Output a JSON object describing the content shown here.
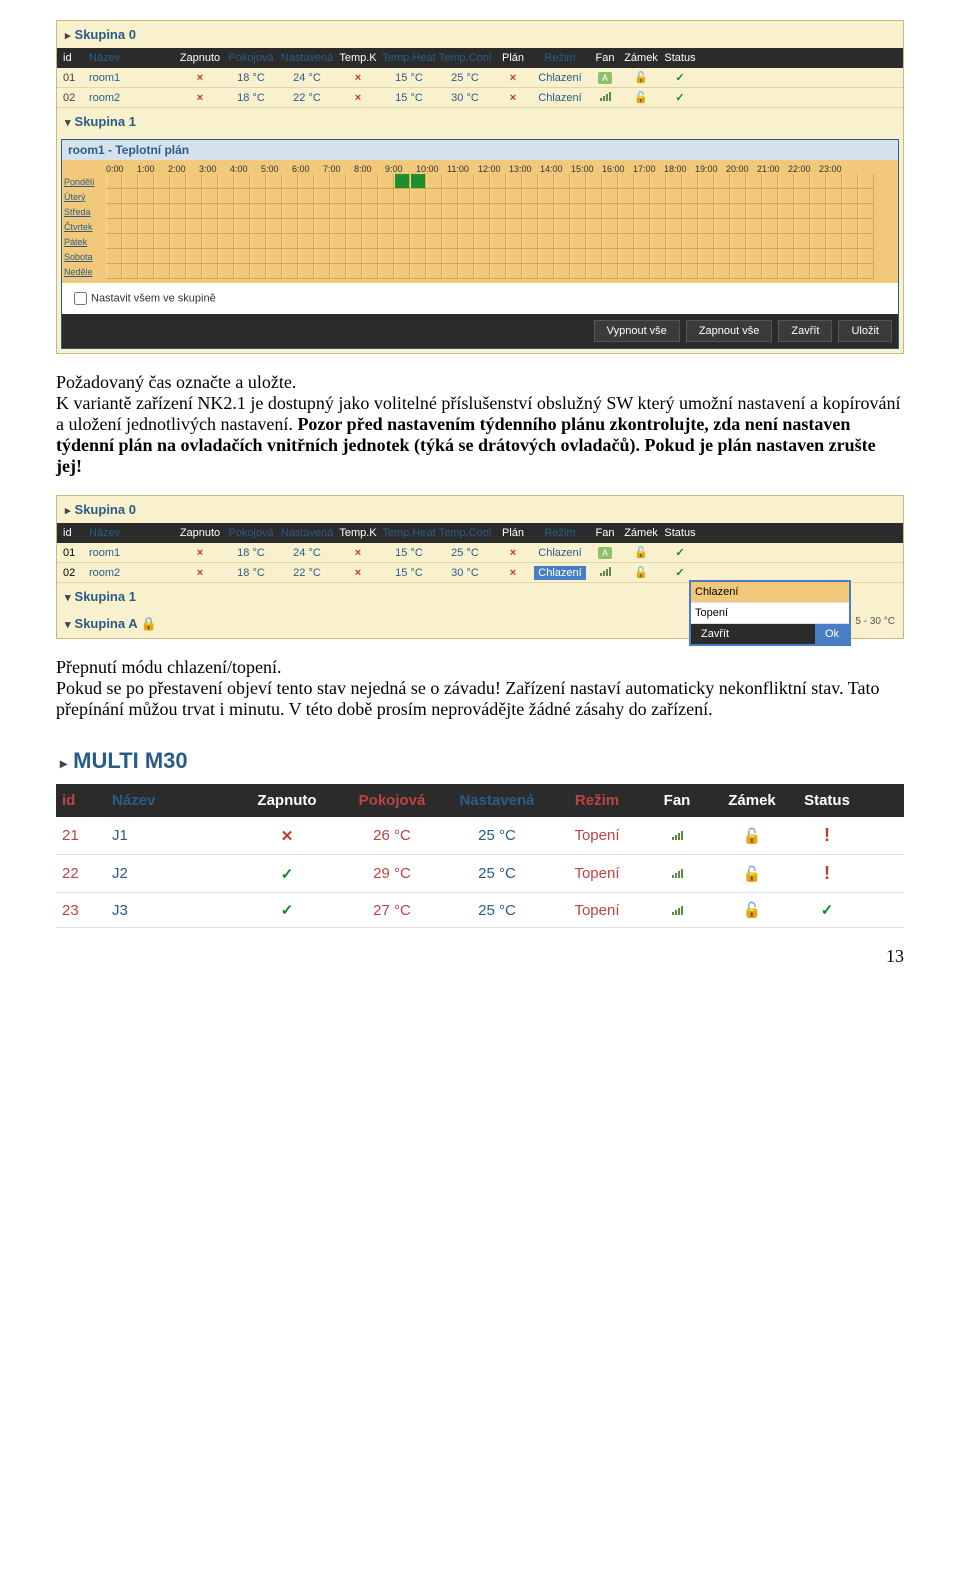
{
  "panel1": {
    "group0": "Skupina 0",
    "group1": "Skupina 1",
    "headers": [
      "id",
      "Název",
      "Zapnuto",
      "Pokojová",
      "Nastavená",
      "Temp.K",
      "Temp.Heat",
      "Temp.Cool",
      "Plán",
      "Režim",
      "Fan",
      "Zámek",
      "Status"
    ],
    "rows": [
      {
        "id": "01",
        "name": "room1",
        "zap": "×",
        "pok": "18 °C",
        "nast": "24 °C",
        "tk": "×",
        "th": "15 °C",
        "tc": "25 °C",
        "plan": "×",
        "rezim": "Chlazení",
        "fan": "A",
        "lock": true,
        "status": true
      },
      {
        "id": "02",
        "name": "room2",
        "zap": "×",
        "pok": "18 °C",
        "nast": "22 °C",
        "tk": "×",
        "th": "15 °C",
        "tc": "30 °C",
        "plan": "×",
        "rezim": "Chlazení",
        "fan": "bars",
        "lock": true,
        "status": true
      }
    ],
    "plan": {
      "title": "room1 - Teplotní plán",
      "hours": [
        "0:00",
        "1:00",
        "2:00",
        "3:00",
        "4:00",
        "5:00",
        "6:00",
        "7:00",
        "8:00",
        "9:00",
        "10:00",
        "11:00",
        "12:00",
        "13:00",
        "14:00",
        "15:00",
        "16:00",
        "17:00",
        "18:00",
        "19:00",
        "20:00",
        "21:00",
        "22:00",
        "23:00"
      ],
      "days": [
        "Pondělí",
        "Úterý",
        "Středa",
        "Čtvrtek",
        "Pátek",
        "Sobota",
        "Neděle"
      ],
      "check": "Nastavit všem ve skupině",
      "buttons": [
        "Vypnout vše",
        "Zapnout vše",
        "Zavřít",
        "Uložit"
      ]
    }
  },
  "para1": {
    "l1": "Požadovaný čas označte a uložte.",
    "l2a": "K variantě zařízení NK2.1 je dostupný jako volitelné příslušenství obslužný SW který umožní nastavení a kopírování a uložení jednotlivých nastavení. ",
    "l2b": "Pozor před nastavením týdenního plánu zkontrolujte, zda není nastaven týdenní plán na ovladačích vnitřních jednotek (týká se drátových ovladačů). Pokud je plán nastaven zrušte jej!"
  },
  "panel2": {
    "group0": "Skupina 0",
    "group1": "Skupina 1",
    "groupA": "Skupina A",
    "headers": [
      "id",
      "Název",
      "Zapnuto",
      "Pokojová",
      "Nastavená",
      "Temp.K",
      "Temp.Heat",
      "Temp.Cool",
      "Plán",
      "Režim",
      "Fan",
      "Zámek",
      "Status"
    ],
    "rows": [
      {
        "id": "01",
        "name": "room1",
        "zap": "×",
        "pok": "18 °C",
        "nast": "24 °C",
        "tk": "×",
        "th": "15 °C",
        "tc": "25 °C",
        "plan": "×",
        "rezim": "Chlazení",
        "fan": "A",
        "lock": true,
        "status": true
      },
      {
        "id": "02",
        "name": "room2",
        "zap": "×",
        "pok": "18 °C",
        "nast": "22 °C",
        "tk": "×",
        "th": "15 °C",
        "tc": "30 °C",
        "plan": "×",
        "rezim": "Chlazení",
        "fan": "bars",
        "lock": true,
        "status": true
      }
    ],
    "popup": {
      "opt1": "Chlazení",
      "opt2": "Topení",
      "close": "Zavřít",
      "ok": "Ok"
    },
    "footnote": "5 - 30 °C"
  },
  "para2": {
    "l1": "Přepnutí módu chlazení/topení.",
    "l2": "Pokud se po přestavení objeví tento stav nejedná se o závadu! Zařízení nastaví automaticky nekonfliktní stav. Tato přepínání můžou trvat i minutu. V této době prosím neprovádějte žádné zásahy do zařízení."
  },
  "panel3": {
    "title": "MULTI M30",
    "headers": [
      "id",
      "Název",
      "Zapnuto",
      "Pokojová",
      "Nastavená",
      "Režim",
      "Fan",
      "Zámek",
      "Status"
    ],
    "rows": [
      {
        "id": "21",
        "name": "J1",
        "zap": "x",
        "pok": "26 °C",
        "nast": "25 °C",
        "rezim": "Topení",
        "status": "!"
      },
      {
        "id": "22",
        "name": "J2",
        "zap": "v",
        "pok": "29 °C",
        "nast": "25 °C",
        "rezim": "Topení",
        "status": "!"
      },
      {
        "id": "23",
        "name": "J3",
        "zap": "v",
        "pok": "27 °C",
        "nast": "25 °C",
        "rezim": "Topení",
        "status": "v"
      }
    ]
  },
  "pagenum": "13"
}
